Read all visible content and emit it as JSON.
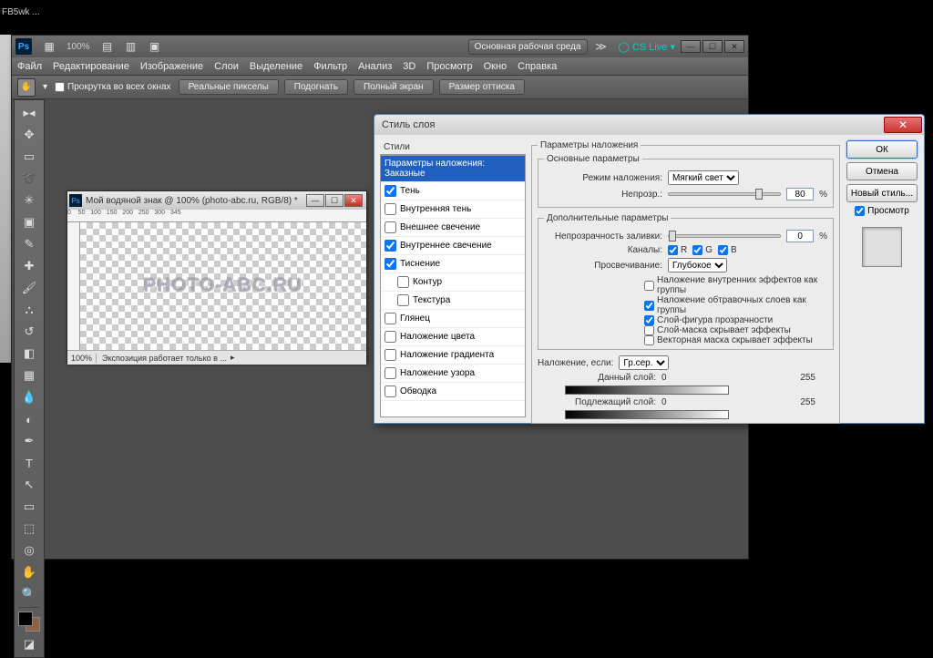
{
  "taskbar_title": "FB5wk ...",
  "app": {
    "logo": "Ps",
    "zoom_readout": "100%",
    "workspace_btn": "Основная рабочая среда",
    "cslive": "CS Live"
  },
  "menu": [
    "Файл",
    "Редактирование",
    "Изображение",
    "Слои",
    "Выделение",
    "Фильтр",
    "Анализ",
    "3D",
    "Просмотр",
    "Окно",
    "Справка"
  ],
  "options": {
    "scroll_all": "Прокрутка во всех окнах",
    "btns": [
      "Реальные пикселы",
      "Подогнать",
      "Полный экран",
      "Размер оттиска"
    ]
  },
  "tools": [
    "move",
    "marquee",
    "lasso",
    "wand",
    "crop",
    "eyedropper",
    "heal",
    "brush",
    "stamp",
    "history",
    "eraser",
    "gradient",
    "blur",
    "dodge",
    "pen",
    "type",
    "path",
    "shape",
    "3d",
    "cam3d",
    "hand",
    "zoom"
  ],
  "doc": {
    "title": "Мой водяной знак @ 100% (photo-abc.ru, RGB/8) *",
    "watermark": "PHOTO-ABC.RU",
    "zoom": "100%",
    "status": "Экспозиция работает только в ..."
  },
  "dialog": {
    "title": "Стиль слоя",
    "styles_header": "Стили",
    "effects": [
      {
        "label": "Параметры наложения: Заказные",
        "selected": true,
        "cb": false
      },
      {
        "label": "Тень",
        "checked": true
      },
      {
        "label": "Внутренняя тень",
        "checked": false
      },
      {
        "label": "Внешнее свечение",
        "checked": false
      },
      {
        "label": "Внутреннее свечение",
        "checked": true
      },
      {
        "label": "Тиснение",
        "checked": true
      },
      {
        "label": "Контур",
        "checked": false,
        "indent": true
      },
      {
        "label": "Текстура",
        "checked": false,
        "indent": true
      },
      {
        "label": "Глянец",
        "checked": false
      },
      {
        "label": "Наложение цвета",
        "checked": false
      },
      {
        "label": "Наложение градиента",
        "checked": false
      },
      {
        "label": "Наложение узора",
        "checked": false
      },
      {
        "label": "Обводка",
        "checked": false
      }
    ],
    "params": {
      "fs1": "Параметры наложения",
      "fs2": "Основные параметры",
      "blend_mode_lbl": "Режим наложения:",
      "blend_mode": "Мягкий свет",
      "opacity_lbl": "Непрозр.:",
      "opacity": "80",
      "fs3": "Дополнительные параметры",
      "fill_lbl": "Непрозрачность заливки:",
      "fill": "0",
      "channels_lbl": "Каналы:",
      "ch": [
        "R",
        "G",
        "B"
      ],
      "knockout_lbl": "Просвечивание:",
      "knockout": "Глубокое",
      "flags": [
        {
          "t": "Наложение внутренних эффектов как группы",
          "c": false
        },
        {
          "t": "Наложение обтравочных слоев как группы",
          "c": true
        },
        {
          "t": "Слой-фигура прозрачности",
          "c": true
        },
        {
          "t": "Слой-маска скрывает эффекты",
          "c": false
        },
        {
          "t": "Векторная маска скрывает эффекты",
          "c": false
        }
      ],
      "blendif_lbl": "Наложение, если:",
      "blendif": "Гр.сер.",
      "this_lbl": "Данный слой:",
      "this_lo": "0",
      "this_hi": "255",
      "under_lbl": "Подлежащий слой:",
      "under_lo": "0",
      "under_hi": "255"
    },
    "btns": {
      "ok": "ОК",
      "cancel": "Отмена",
      "new_style": "Новый стиль...",
      "preview": "Просмотр"
    }
  }
}
